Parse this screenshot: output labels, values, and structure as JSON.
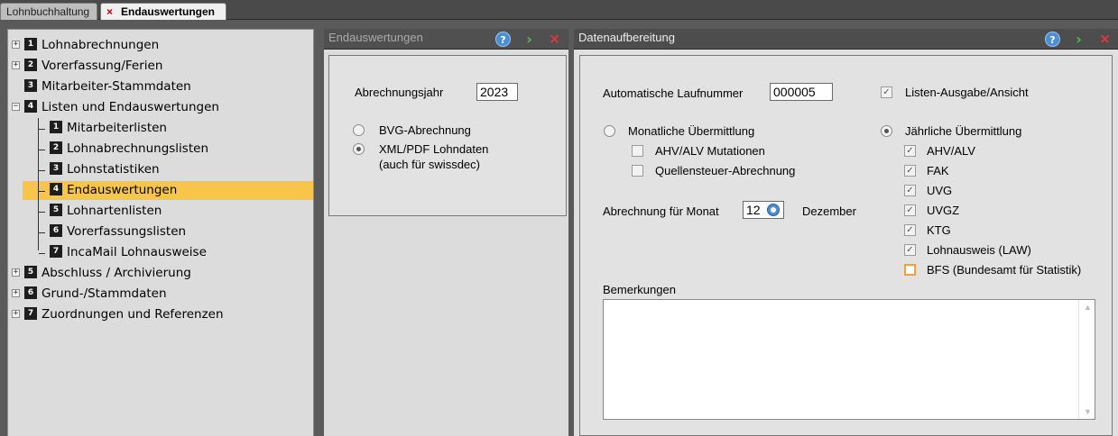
{
  "tabs": [
    {
      "label": "Lohnbuchhaltung"
    },
    {
      "label": "Endauswertungen",
      "close": "×"
    }
  ],
  "tree": {
    "items": [
      {
        "num": "1",
        "label": "Lohnabrechnungen",
        "expander": "+"
      },
      {
        "num": "2",
        "label": "Vorerfassung/Ferien",
        "expander": "+"
      },
      {
        "num": "3",
        "label": "Mitarbeiter-Stammdaten"
      },
      {
        "num": "4",
        "label": "Listen und Endauswertungen",
        "expander": "−"
      },
      {
        "num": "1",
        "label": "Mitarbeiterlisten"
      },
      {
        "num": "2",
        "label": "Lohnabrechnungslisten"
      },
      {
        "num": "3",
        "label": "Lohnstatistiken"
      },
      {
        "num": "4",
        "label": "Endauswertungen",
        "selected": true
      },
      {
        "num": "5",
        "label": "Lohnartenlisten"
      },
      {
        "num": "6",
        "label": "Vorerfassungslisten"
      },
      {
        "num": "7",
        "label": "IncaMail Lohnausweise"
      },
      {
        "num": "5",
        "label": "Abschluss / Archivierung",
        "expander": "+"
      },
      {
        "num": "6",
        "label": "Grund-/Stammdaten",
        "expander": "+"
      },
      {
        "num": "7",
        "label": "Zuordnungen und Referenzen",
        "expander": "+"
      }
    ]
  },
  "panel1": {
    "title": "Endauswertungen",
    "year_label": "Abrechnungsjahr",
    "year_value": "2023",
    "radio_bvg": "BVG-Abrechnung",
    "radio_xml": "XML/PDF Lohndaten",
    "radio_xml_note": "(auch für swissdec)"
  },
  "panel2": {
    "title": "Datenaufbereitung",
    "laufnummer_label": "Automatische Laufnummer",
    "laufnummer_value": "000005",
    "listen_ausgabe": "Listen-Ausgabe/Ansicht",
    "monatlich": "Monatliche Übermittlung",
    "ahv_mutationen": "AHV/ALV Mutationen",
    "quellensteuer": "Quellensteuer-Abrechnung",
    "jaehrlich": "Jährliche Übermittlung",
    "jahr_items": [
      "AHV/ALV",
      "FAK",
      "UVG",
      "UVGZ",
      "KTG",
      "Lohnausweis (LAW)"
    ],
    "bfs": "BFS (Bundesamt für Statistik)",
    "monat_label": "Abrechnung für Monat",
    "monat_value": "12",
    "monat_name": "Dezember",
    "bemerkungen_label": "Bemerkungen"
  },
  "icons": {
    "help": "?",
    "go": "›",
    "close": "×",
    "check": "✓",
    "scroll_up": "▲",
    "scroll_down": "▼"
  }
}
